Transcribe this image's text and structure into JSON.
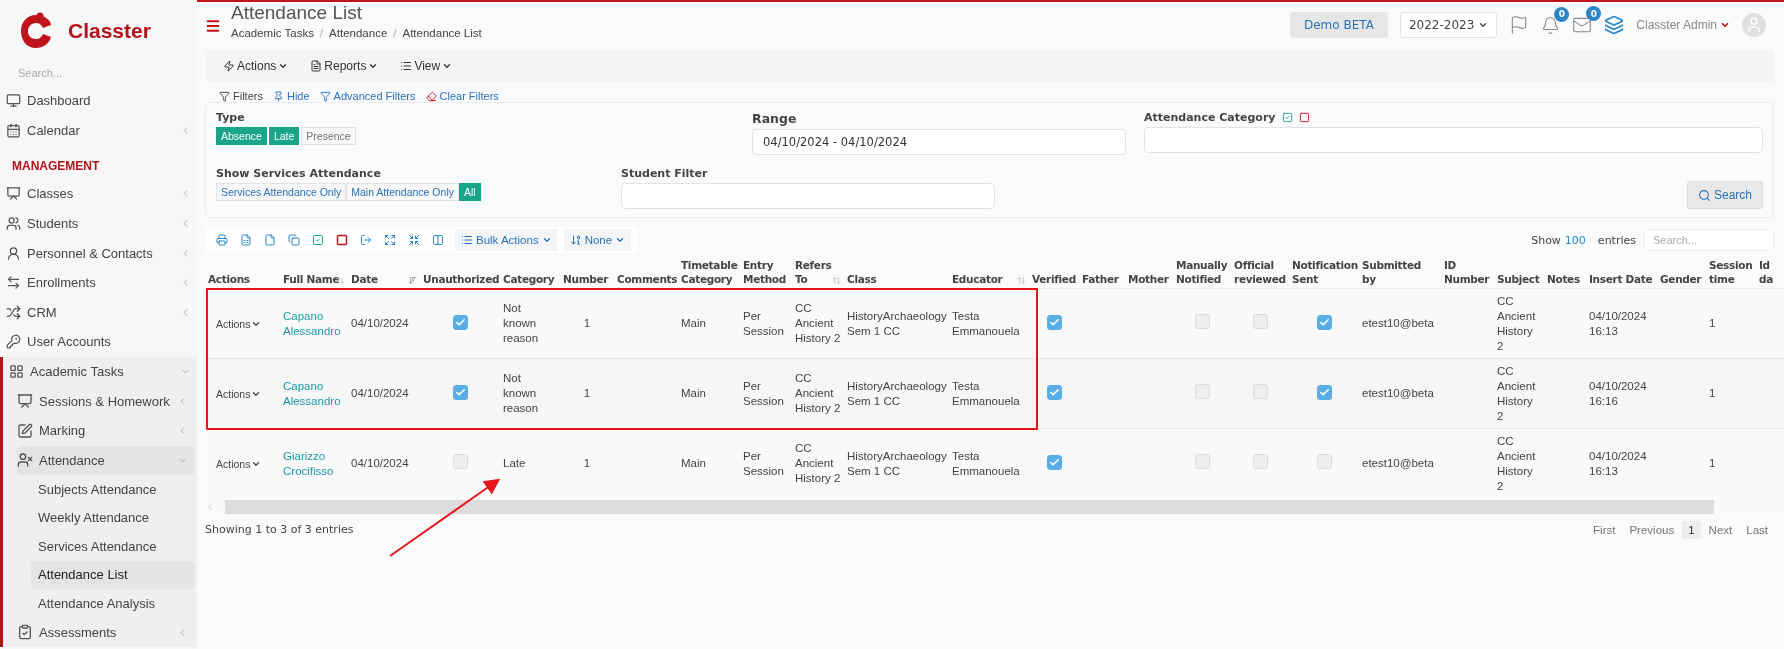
{
  "sidebar": {
    "logo": "Classter",
    "search_placeholder": "Search...",
    "items": [
      {
        "kind": "link",
        "label": "Dashboard",
        "selected": false
      },
      {
        "kind": "link",
        "label": "Calendar",
        "selected": false,
        "expanded": false
      },
      {
        "kind": "heading",
        "label": "MANAGEMENT"
      },
      {
        "kind": "link",
        "label": "Classes",
        "selected": false,
        "expanded": false
      },
      {
        "kind": "link",
        "label": "Students",
        "selected": false,
        "expanded": false
      },
      {
        "kind": "link",
        "label": "Personnel & Contacts",
        "selected": false,
        "expanded": false
      },
      {
        "kind": "link",
        "label": "Enrollments",
        "selected": false,
        "expanded": false
      },
      {
        "kind": "link",
        "label": "CRM",
        "selected": false,
        "expanded": false
      },
      {
        "kind": "link",
        "label": "User Accounts",
        "selected": false
      },
      {
        "kind": "link",
        "label": "Academic Tasks",
        "selected": false,
        "expanded": true,
        "children": [
          {
            "kind": "link",
            "label": "Sessions & Homework",
            "selected": false,
            "expanded": false
          },
          {
            "kind": "link",
            "label": "Marking",
            "selected": false,
            "expanded": false
          },
          {
            "kind": "link",
            "label": "Attendance",
            "selected": false,
            "expanded": true,
            "children": [
              {
                "kind": "link",
                "label": "Subjects Attendance",
                "selected": false
              },
              {
                "kind": "link",
                "label": "Weekly Attendance",
                "selected": false
              },
              {
                "kind": "link",
                "label": "Services Attendance",
                "selected": false
              },
              {
                "kind": "link",
                "label": "Attendance List",
                "selected": true
              },
              {
                "kind": "link",
                "label": "Attendance Analysis",
                "selected": false
              }
            ]
          },
          {
            "kind": "link",
            "label": "Assessments",
            "selected": false,
            "expanded": false
          }
        ]
      }
    ]
  },
  "header": {
    "title": "Attendance List",
    "breadcrumb": [
      "Academic Tasks",
      "Attendance",
      "Attendance List"
    ],
    "breadcrumb_separator": "/",
    "environment": "Demo BETA",
    "year": "2022-2023",
    "notifications": "0",
    "messages": "0",
    "user": "Classter Admin"
  },
  "toolbar": [
    "Actions",
    "Reports",
    "View"
  ],
  "filters": {
    "legend": "Filters",
    "links": [
      "Hide",
      "Advanced Filters",
      "Clear Filters"
    ],
    "type": {
      "label": "Type",
      "options": [
        {
          "label": "Absence",
          "selected": true
        },
        {
          "label": "Late",
          "selected": true
        },
        {
          "label": "Presence",
          "selected": false
        }
      ]
    },
    "services": {
      "label": "Show Services Attendance",
      "options": [
        {
          "label": "Services Attendance Only",
          "selected": false
        },
        {
          "label": "Main Attendance Only",
          "selected": false
        },
        {
          "label": "All",
          "selected": true
        }
      ]
    },
    "range": {
      "label": "Range",
      "value": "04/10/2024 - 04/10/2024"
    },
    "student": {
      "label": "Student Filter"
    },
    "category": {
      "label": "Attendance Category"
    },
    "search_button": "Search"
  },
  "table_tools": {
    "bulk": "Bulk Actions",
    "sort": "None",
    "show": "Show",
    "entries_count": "100",
    "entries": "entries",
    "search_placeholder": "Search..."
  },
  "table": {
    "columns": [
      {
        "label": "Actions"
      },
      {
        "label": "Full Name",
        "sortable": true
      },
      {
        "label": "Date",
        "sortable": true,
        "sorted": true
      },
      {
        "label": "Unauthorized"
      },
      {
        "label": "Category"
      },
      {
        "label": "Number"
      },
      {
        "label": "Comments"
      },
      {
        "label": "Timetable Category"
      },
      {
        "label": "Entry Method"
      },
      {
        "label": "Refers To",
        "sortable": true
      },
      {
        "label": "Class"
      },
      {
        "label": "Educator",
        "sortable": true
      },
      {
        "label": "Verified"
      },
      {
        "label": "Father"
      },
      {
        "label": "Mother"
      },
      {
        "label": "Manually Notified"
      },
      {
        "label": "Official reviewed"
      },
      {
        "label": "Notification Sent"
      },
      {
        "label": "Submitted by"
      },
      {
        "label": "ID Number"
      },
      {
        "label": "Subject"
      },
      {
        "label": "Notes"
      },
      {
        "label": "Insert Date"
      },
      {
        "label": "Gender"
      },
      {
        "label": "Session time"
      },
      {
        "label": "Id da"
      }
    ],
    "rows": [
      {
        "highlighted": true,
        "cells": [
          {
            "kind": "actions",
            "text": "Actions"
          },
          {
            "kind": "link",
            "text": "Capano Alessandro"
          },
          {
            "kind": "text",
            "text": "04/10/2024"
          },
          {
            "kind": "check",
            "checked": true
          },
          {
            "kind": "text",
            "text": "Not known reason"
          },
          {
            "kind": "num",
            "text": "1"
          },
          {
            "kind": "empty"
          },
          {
            "kind": "text",
            "text": "Main"
          },
          {
            "kind": "text",
            "text": "Per Session"
          },
          {
            "kind": "text",
            "text": "CC Ancient History 2"
          },
          {
            "kind": "text",
            "text": "HistoryArchaeology Sem 1 CC"
          },
          {
            "kind": "text",
            "text": "Testa Emmanouela"
          },
          {
            "kind": "check",
            "checked": true
          },
          {
            "kind": "empty"
          },
          {
            "kind": "empty"
          },
          {
            "kind": "check",
            "checked": false
          },
          {
            "kind": "check",
            "checked": false
          },
          {
            "kind": "check",
            "checked": true
          },
          {
            "kind": "text",
            "text": "etest10@beta"
          },
          {
            "kind": "empty"
          },
          {
            "kind": "text",
            "text": "CC Ancient History 2"
          },
          {
            "kind": "empty"
          },
          {
            "kind": "text",
            "text": "04/10/2024 16:13"
          },
          {
            "kind": "empty"
          },
          {
            "kind": "text",
            "text": "1"
          },
          {
            "kind": "empty"
          }
        ]
      },
      {
        "highlighted": true,
        "cells": [
          {
            "kind": "actions",
            "text": "Actions"
          },
          {
            "kind": "link",
            "text": "Capano Alessandro"
          },
          {
            "kind": "text",
            "text": "04/10/2024"
          },
          {
            "kind": "check",
            "checked": true
          },
          {
            "kind": "text",
            "text": "Not known reason"
          },
          {
            "kind": "num",
            "text": "1"
          },
          {
            "kind": "empty"
          },
          {
            "kind": "text",
            "text": "Main"
          },
          {
            "kind": "text",
            "text": "Per Session"
          },
          {
            "kind": "text",
            "text": "CC Ancient History 2"
          },
          {
            "kind": "text",
            "text": "HistoryArchaeology Sem 1 CC"
          },
          {
            "kind": "text",
            "text": "Testa Emmanouela"
          },
          {
            "kind": "check",
            "checked": true
          },
          {
            "kind": "empty"
          },
          {
            "kind": "empty"
          },
          {
            "kind": "check",
            "checked": false
          },
          {
            "kind": "check",
            "checked": false
          },
          {
            "kind": "check",
            "checked": true
          },
          {
            "kind": "text",
            "text": "etest10@beta"
          },
          {
            "kind": "empty"
          },
          {
            "kind": "text",
            "text": "CC Ancient History 2"
          },
          {
            "kind": "empty"
          },
          {
            "kind": "text",
            "text": "04/10/2024 16:16"
          },
          {
            "kind": "empty"
          },
          {
            "kind": "text",
            "text": "1"
          },
          {
            "kind": "empty"
          }
        ]
      },
      {
        "highlighted": false,
        "cells": [
          {
            "kind": "actions",
            "text": "Actions"
          },
          {
            "kind": "link",
            "text": "Giarizzo Crocifisso"
          },
          {
            "kind": "text",
            "text": "04/10/2024"
          },
          {
            "kind": "check",
            "checked": false
          },
          {
            "kind": "text",
            "text": "Late"
          },
          {
            "kind": "num",
            "text": "1"
          },
          {
            "kind": "empty"
          },
          {
            "kind": "text",
            "text": "Main"
          },
          {
            "kind": "text",
            "text": "Per Session"
          },
          {
            "kind": "text",
            "text": "CC Ancient History 2"
          },
          {
            "kind": "text",
            "text": "HistoryArchaeology Sem 1 CC"
          },
          {
            "kind": "text",
            "text": "Testa Emmanouela"
          },
          {
            "kind": "check",
            "checked": true
          },
          {
            "kind": "empty"
          },
          {
            "kind": "empty"
          },
          {
            "kind": "check",
            "checked": false
          },
          {
            "kind": "check",
            "checked": false
          },
          {
            "kind": "check",
            "checked": false
          },
          {
            "kind": "text",
            "text": "etest10@beta"
          },
          {
            "kind": "empty"
          },
          {
            "kind": "text",
            "text": "CC Ancient History 2"
          },
          {
            "kind": "empty"
          },
          {
            "kind": "text",
            "text": "04/10/2024 16:13"
          },
          {
            "kind": "empty"
          },
          {
            "kind": "text",
            "text": "1"
          },
          {
            "kind": "empty"
          }
        ]
      }
    ]
  },
  "footer": {
    "info": "Showing 1 to 3 of 3 entries",
    "pages": [
      {
        "label": "First",
        "selected": false
      },
      {
        "label": "Previous",
        "selected": false
      },
      {
        "label": "1",
        "selected": true
      },
      {
        "label": "Next",
        "selected": false
      },
      {
        "label": "Last",
        "selected": false
      }
    ]
  }
}
